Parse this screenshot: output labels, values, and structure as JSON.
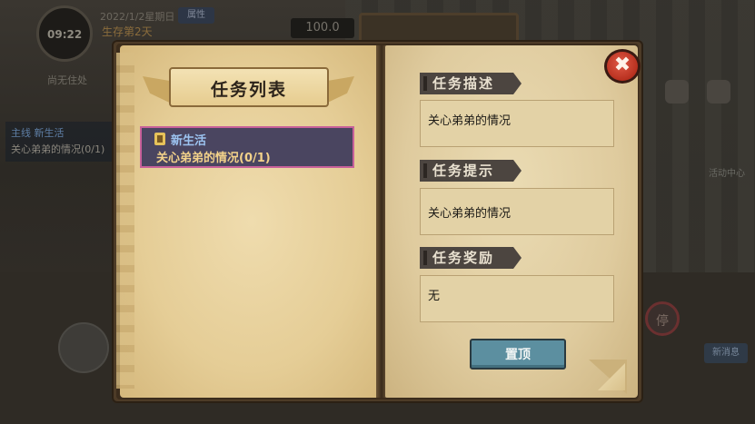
{
  "background": {
    "clock": "09:22",
    "date": "2022/1/2星期日",
    "attr_button": "属性",
    "survive_day": "生存第2天",
    "money": "100.0",
    "no_home": "尚无住处",
    "quest_tag": "主线 新生活",
    "quest_progress": "关心弟弟的情况(0/1)",
    "news": "新消息",
    "stop_sign": "停",
    "activity": "活动中心"
  },
  "dialog": {
    "list_title": "任务列表",
    "quests": [
      {
        "title": "新生活",
        "progress": "关心弟弟的情况(0/1)",
        "selected": true,
        "icon": "clipboard-icon"
      }
    ],
    "description": {
      "header": "任务描述",
      "text": "关心弟弟的情况"
    },
    "hint": {
      "header": "任务提示",
      "text": "关心弟弟的情况"
    },
    "reward": {
      "header": "任务奖励",
      "text": "无"
    },
    "pin_button": "置顶",
    "close_icon": "close-icon"
  },
  "colors": {
    "selection_border": "#c8619a",
    "quest_title": "#9cc3f0",
    "quest_progress": "#f3d28a",
    "button": "#5c8fa0",
    "close": "#c0392b"
  }
}
